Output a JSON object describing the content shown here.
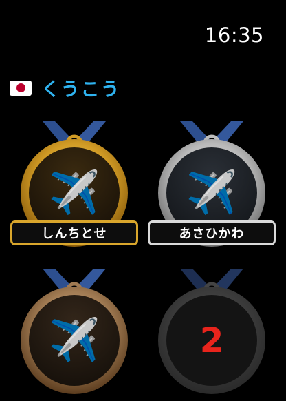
{
  "status_bar": {
    "time": "16:35"
  },
  "header": {
    "flag_icon": "japan-flag-icon",
    "title": "くうこう"
  },
  "medals": [
    {
      "tier": "gold",
      "label": "しんちとせ",
      "icon": "airplane-icon",
      "locked": false
    },
    {
      "tier": "silver",
      "label": "あさひかわ",
      "icon": "airplane-icon",
      "locked": false
    },
    {
      "tier": "bronze",
      "label": "",
      "icon": "airplane-icon",
      "locked": false
    },
    {
      "tier": "locked",
      "label": "",
      "icon": "",
      "locked": true,
      "lock_value": "2"
    }
  ],
  "colors": {
    "title": "#2fb3f0",
    "gold": "#d9a62c",
    "silver": "#d9d9d9",
    "bronze": "#a07a52",
    "ribbon": "#2d4f8f",
    "locked_number": "#e8241c"
  }
}
